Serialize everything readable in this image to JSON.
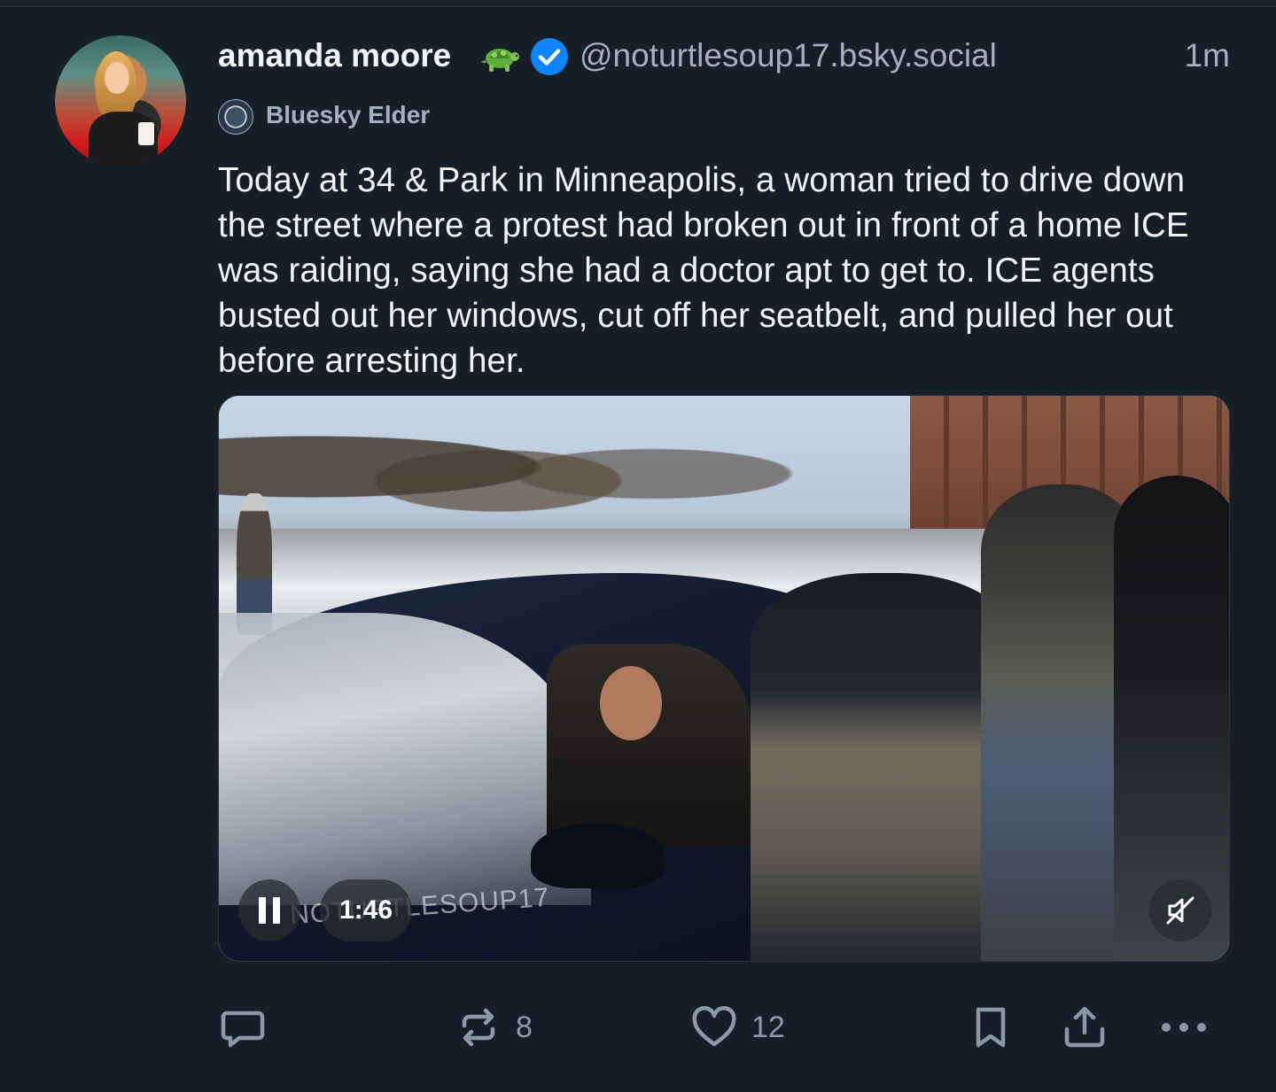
{
  "post": {
    "author_name": "amanda moore",
    "author_emoji": "🐢",
    "handle": "@noturtlesoup17.bsky.social",
    "time": "1m",
    "badge_label": "Bluesky Elder",
    "text": "Today at 34 & Park in Minneapolis, a woman tried to drive down the street where a protest had broken out in front of a home ICE was raiding, saying she had a doctor apt to get to. ICE agents busted out her windows, cut off her seatbelt, and pulled her out before arresting her."
  },
  "video": {
    "duration": "1:46",
    "watermark": "NOTURTLESOUP17",
    "playing": true,
    "muted": true
  },
  "actions": {
    "reply_count": "",
    "repost_count": "8",
    "like_count": "12"
  },
  "colors": {
    "background": "#161e27",
    "text_primary": "#f1f3f5",
    "text_secondary": "#a3b0bf",
    "verified": "#1083fe",
    "icon": "#8a98a8"
  },
  "icons": {
    "verified": "verified-check-icon",
    "turtle": "turtle-emoji-icon",
    "badge": "bluesky-elder-badge-icon",
    "pause": "pause-icon",
    "mute": "muted-speaker-icon",
    "reply": "reply-bubble-icon",
    "repost": "repost-icon",
    "like": "heart-icon",
    "bookmark": "bookmark-icon",
    "share": "share-icon",
    "more": "more-dots-icon"
  }
}
